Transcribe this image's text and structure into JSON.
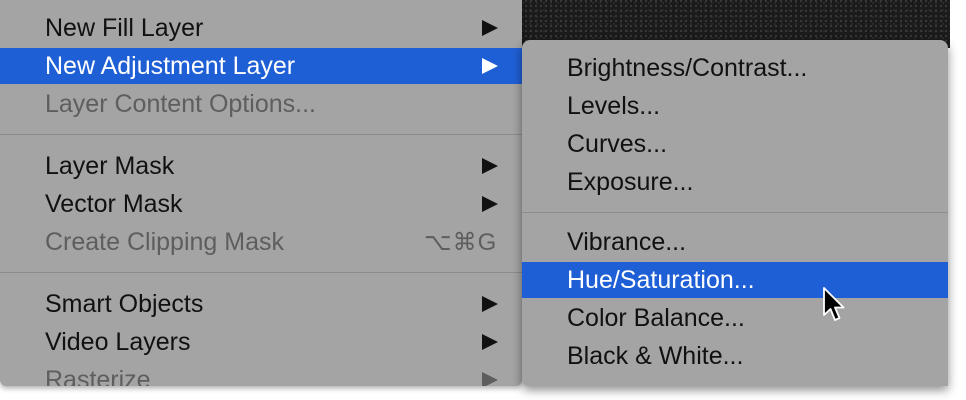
{
  "main_menu": {
    "items": [
      {
        "label": "New Fill Layer",
        "has_submenu": true
      },
      {
        "label": "New Adjustment Layer",
        "has_submenu": true,
        "selected": true
      },
      {
        "label": "Layer Content Options...",
        "disabled": true
      },
      {
        "label": "Layer Mask",
        "has_submenu": true
      },
      {
        "label": "Vector Mask",
        "has_submenu": true
      },
      {
        "label": "Create Clipping Mask",
        "disabled": true,
        "shortcut": "⌥⌘G"
      },
      {
        "label": "Smart Objects",
        "has_submenu": true
      },
      {
        "label": "Video Layers",
        "has_submenu": true
      },
      {
        "label": "Rasterize",
        "has_submenu": true,
        "disabled": true
      }
    ]
  },
  "submenu": {
    "items": [
      {
        "label": "Brightness/Contrast..."
      },
      {
        "label": "Levels..."
      },
      {
        "label": "Curves..."
      },
      {
        "label": "Exposure..."
      },
      {
        "label": "Vibrance..."
      },
      {
        "label": "Hue/Saturation...",
        "selected": true
      },
      {
        "label": "Color Balance..."
      },
      {
        "label": "Black & White..."
      }
    ]
  },
  "colors": {
    "menu_bg": "#a4a4a4",
    "highlight": "#1f5fd6",
    "text": "#111111",
    "disabled_text": "#5e5e5e"
  },
  "icons": {
    "submenu_arrow": "triangle-right-icon",
    "cursor": "mouse-pointer-icon"
  }
}
